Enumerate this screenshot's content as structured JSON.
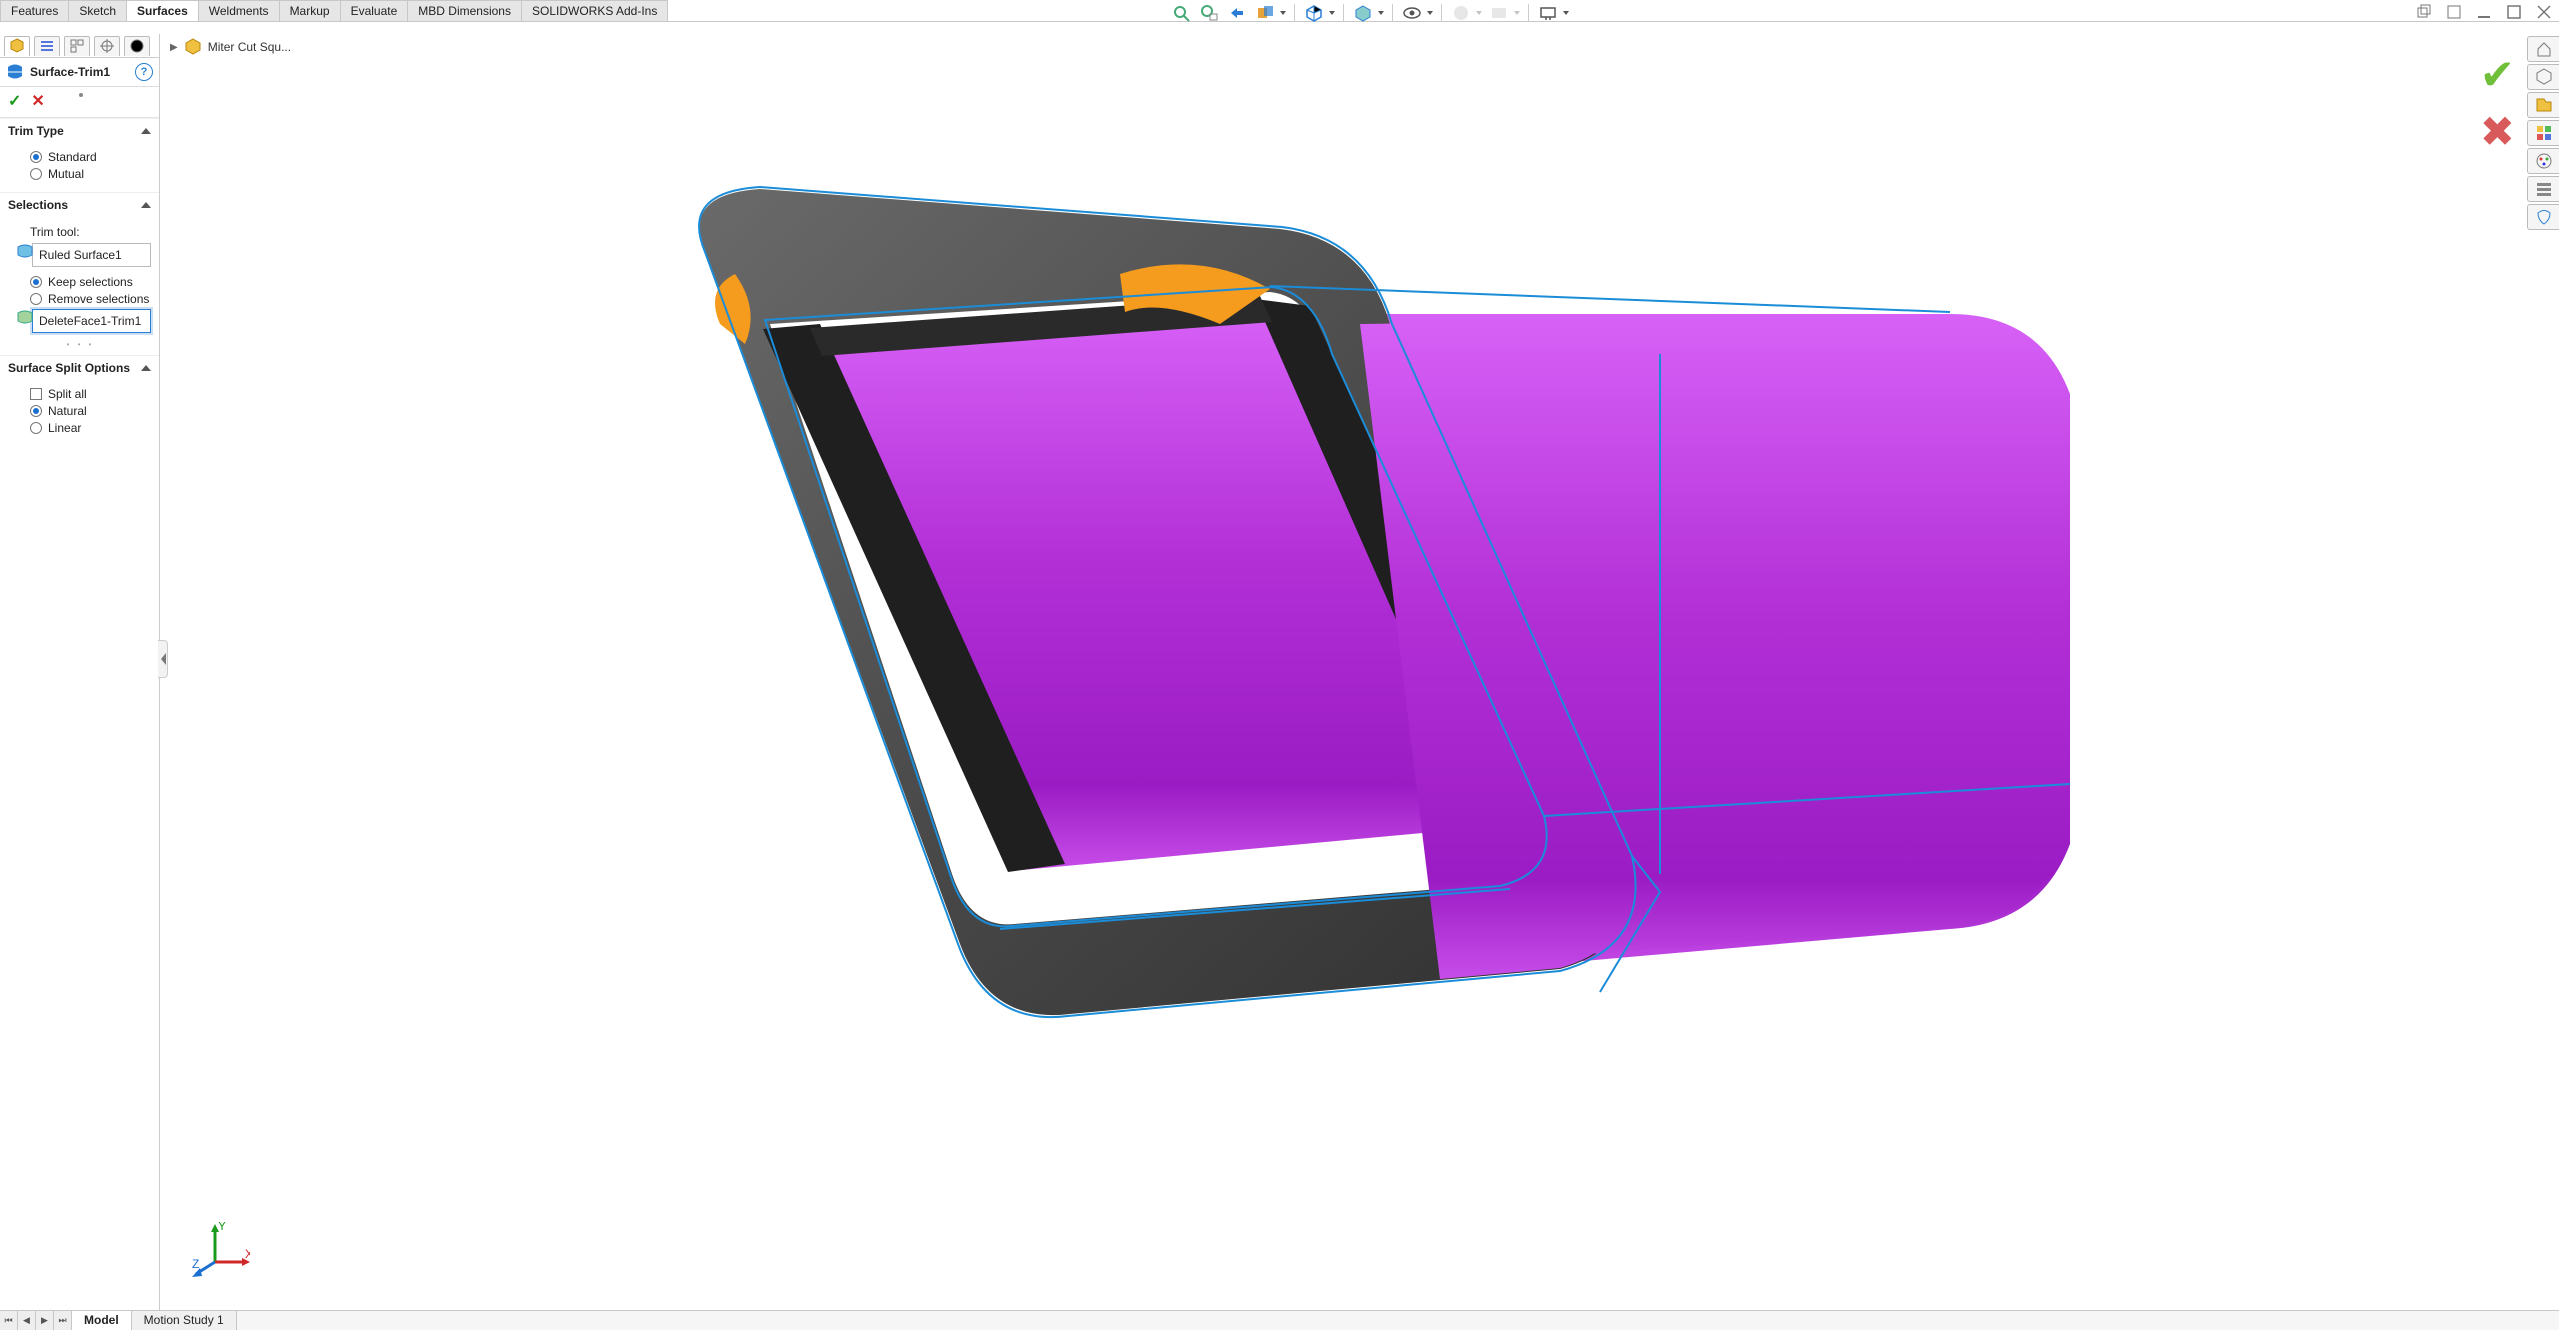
{
  "ribbon": {
    "tabs": [
      "Features",
      "Sketch",
      "Surfaces",
      "Weldments",
      "Markup",
      "Evaluate",
      "MBD Dimensions",
      "SOLIDWORKS Add-Ins"
    ],
    "active_index": 2
  },
  "view_toolbar": {
    "icons": [
      "zoom-fit",
      "zoom-area",
      "previous-view",
      "section-view",
      "view-orientation",
      "display-style",
      "hide-show",
      "edit-appearance",
      "apply-scene",
      "view-settings"
    ],
    "dropdown_flags": [
      false,
      false,
      false,
      true,
      true,
      true,
      true,
      true,
      true,
      true
    ],
    "disabled_flags": [
      false,
      false,
      false,
      false,
      false,
      false,
      false,
      true,
      true,
      false
    ]
  },
  "window_controls": [
    "nested-restore",
    "nested-maximize",
    "minimize",
    "maximize",
    "close"
  ],
  "breadcrumb": {
    "part": "Miter Cut Squ..."
  },
  "feature_manager": {
    "tabs": [
      "feature-tree",
      "property-manager",
      "config-manager",
      "dim-expert",
      "display-manager"
    ],
    "active_tab": 0,
    "title": "Surface-Trim1",
    "help_label": "?",
    "ok_symbol": "✓",
    "cancel_symbol": "✕",
    "sections": {
      "trim_type": {
        "title": "Trim Type",
        "options": [
          "Standard",
          "Mutual"
        ],
        "selected": 0
      },
      "selections": {
        "title": "Selections",
        "trim_tool_label": "Trim tool:",
        "trim_tool_value": "Ruled Surface1",
        "keep_remove": [
          "Keep selections",
          "Remove selections"
        ],
        "keep_remove_selected": 0,
        "pieces_value": "DeleteFace1-Trim1"
      },
      "split": {
        "title": "Surface Split Options",
        "split_all_label": "Split all",
        "split_all_checked": false,
        "options": [
          "Natural",
          "Linear"
        ],
        "selected": 0
      }
    }
  },
  "confirm_corner": {
    "ok": "✔",
    "cancel": "✖"
  },
  "taskpane": {
    "tabs": [
      "home",
      "resources",
      "design-library",
      "file-explorer",
      "view-palette",
      "appearances",
      "custom-props"
    ]
  },
  "bottom": {
    "nav": [
      "⏮",
      "◀",
      "▶",
      "⏭"
    ],
    "tabs": [
      "Model",
      "Motion Study 1"
    ],
    "active": 0
  },
  "triad": {
    "x": "X",
    "y": "Y",
    "z": "Z"
  },
  "colors": {
    "surface_fill": "#b331d8",
    "surface_hl": "#d557f5",
    "flange": "#5a5a5a",
    "flange_dark": "#2e2e2e",
    "accent": "#f59b1e",
    "edge": "#1b8cd8"
  }
}
